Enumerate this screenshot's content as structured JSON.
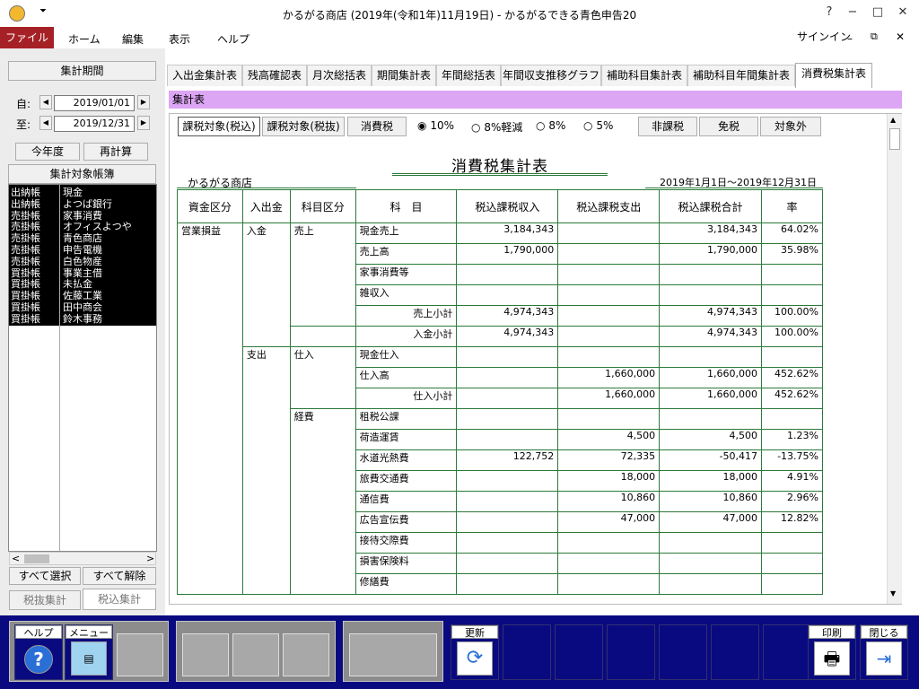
{
  "window": {
    "title": "かるがる商店 (2019年(令和1年)11月19日) - かるがるできる青色申告20",
    "help": "?",
    "minimize": "−",
    "maximize": "□",
    "close": "✕",
    "signin": "サインイン"
  },
  "menu": {
    "file": "ファイル",
    "home": "ホーム",
    "edit": "編集",
    "view": "表示",
    "help": "ヘルプ"
  },
  "left": {
    "period_label": "集計期間",
    "from_label": "自:",
    "from_value": "2019/01/01",
    "to_label": "至:",
    "to_value": "2019/12/31",
    "this_year": "今年度",
    "recalc": "再計算",
    "ledger_title": "集計対象帳簿",
    "ledger_rows": [
      {
        "book": "出納帳",
        "name": "現金"
      },
      {
        "book": "出納帳",
        "name": "よつば銀行"
      },
      {
        "book": "売掛帳",
        "name": "家事消費"
      },
      {
        "book": "売掛帳",
        "name": "オフィスよつや"
      },
      {
        "book": "売掛帳",
        "name": "青色商店"
      },
      {
        "book": "売掛帳",
        "name": "申告電機"
      },
      {
        "book": "売掛帳",
        "name": "白色物産"
      },
      {
        "book": "買掛帳",
        "name": "事業主借"
      },
      {
        "book": "買掛帳",
        "name": "未払金"
      },
      {
        "book": "買掛帳",
        "name": "佐藤工業"
      },
      {
        "book": "買掛帳",
        "name": "田中商会"
      },
      {
        "book": "買掛帳",
        "name": "鈴木事務"
      }
    ],
    "select_all": "すべて選択",
    "deselect_all": "すべて解除",
    "tax_excl": "税抜集計",
    "tax_incl": "税込集計"
  },
  "tabs": [
    "入出金集計表",
    "残高確認表",
    "月次総括表",
    "期間集計表",
    "年間総括表",
    "年間収支推移グラフ",
    "補助科目集計表",
    "補助科目年間集計表",
    "消費税集計表"
  ],
  "section": "集計表",
  "toolbar": {
    "btn1": "課税対象(税込)",
    "btn2": "課税対象(税抜)",
    "btn3": "消費税",
    "radios": [
      "10%",
      "8%軽減",
      "8%",
      "5%"
    ],
    "btn4": "非課税",
    "btn5": "免税",
    "btn6": "対象外"
  },
  "report": {
    "title": "消費税集計表",
    "company": "かるがる商店",
    "period": "2019年1月1日～2019年12月31日",
    "headers": [
      "資金区分",
      "入出金",
      "科目区分",
      "科　目",
      "税込課税収入",
      "税込課税支出",
      "税込課税合計",
      "率"
    ],
    "rows": [
      {
        "c1": "営業損益",
        "c2": "入金",
        "c3": "売上",
        "subject": "現金売上",
        "inc": "3,184,343",
        "exp": "",
        "total": "3,184,343",
        "rate": "64.02%"
      },
      {
        "c1": "",
        "c2": "",
        "c3": "",
        "subject": "売上高",
        "inc": "1,790,000",
        "exp": "",
        "total": "1,790,000",
        "rate": "35.98%"
      },
      {
        "c1": "",
        "c2": "",
        "c3": "",
        "subject": "家事消費等",
        "inc": "",
        "exp": "",
        "total": "",
        "rate": ""
      },
      {
        "c1": "",
        "c2": "",
        "c3": "",
        "subject": "雑収入",
        "inc": "",
        "exp": "",
        "total": "",
        "rate": ""
      },
      {
        "c1": "",
        "c2": "",
        "c3": "",
        "subject": "売上小計",
        "inc": "4,974,343",
        "exp": "",
        "total": "4,974,343",
        "rate": "100.00%"
      },
      {
        "c1": "",
        "c2": "",
        "c3": "",
        "subject": "入金小計",
        "inc": "4,974,343",
        "exp": "",
        "total": "4,974,343",
        "rate": "100.00%"
      },
      {
        "c1": "",
        "c2": "支出",
        "c3": "仕入",
        "subject": "現金仕入",
        "inc": "",
        "exp": "",
        "total": "",
        "rate": ""
      },
      {
        "c1": "",
        "c2": "",
        "c3": "",
        "subject": "仕入高",
        "inc": "",
        "exp": "1,660,000",
        "total": "1,660,000",
        "rate": "452.62%"
      },
      {
        "c1": "",
        "c2": "",
        "c3": "",
        "subject": "仕入小計",
        "inc": "",
        "exp": "1,660,000",
        "total": "1,660,000",
        "rate": "452.62%"
      },
      {
        "c1": "",
        "c2": "",
        "c3": "経費",
        "subject": "租税公課",
        "inc": "",
        "exp": "",
        "total": "",
        "rate": ""
      },
      {
        "c1": "",
        "c2": "",
        "c3": "",
        "subject": "荷造運賃",
        "inc": "",
        "exp": "4,500",
        "total": "4,500",
        "rate": "1.23%"
      },
      {
        "c1": "",
        "c2": "",
        "c3": "",
        "subject": "水道光熱費",
        "inc": "122,752",
        "exp": "72,335",
        "total": "-50,417",
        "rate": "-13.75%"
      },
      {
        "c1": "",
        "c2": "",
        "c3": "",
        "subject": "旅費交通費",
        "inc": "",
        "exp": "18,000",
        "total": "18,000",
        "rate": "4.91%"
      },
      {
        "c1": "",
        "c2": "",
        "c3": "",
        "subject": "通信費",
        "inc": "",
        "exp": "10,860",
        "total": "10,860",
        "rate": "2.96%"
      },
      {
        "c1": "",
        "c2": "",
        "c3": "",
        "subject": "広告宣伝費",
        "inc": "",
        "exp": "47,000",
        "total": "47,000",
        "rate": "12.82%"
      },
      {
        "c1": "",
        "c2": "",
        "c3": "",
        "subject": "接待交際費",
        "inc": "",
        "exp": "",
        "total": "",
        "rate": ""
      },
      {
        "c1": "",
        "c2": "",
        "c3": "",
        "subject": "損害保険料",
        "inc": "",
        "exp": "",
        "total": "",
        "rate": ""
      },
      {
        "c1": "",
        "c2": "",
        "c3": "",
        "subject": "修繕費",
        "inc": "",
        "exp": "",
        "total": "",
        "rate": ""
      }
    ]
  },
  "fkeys": {
    "help": "ヘルプ",
    "menu": "メニュー",
    "refresh": "更新",
    "print": "印刷",
    "close": "閉じる"
  }
}
